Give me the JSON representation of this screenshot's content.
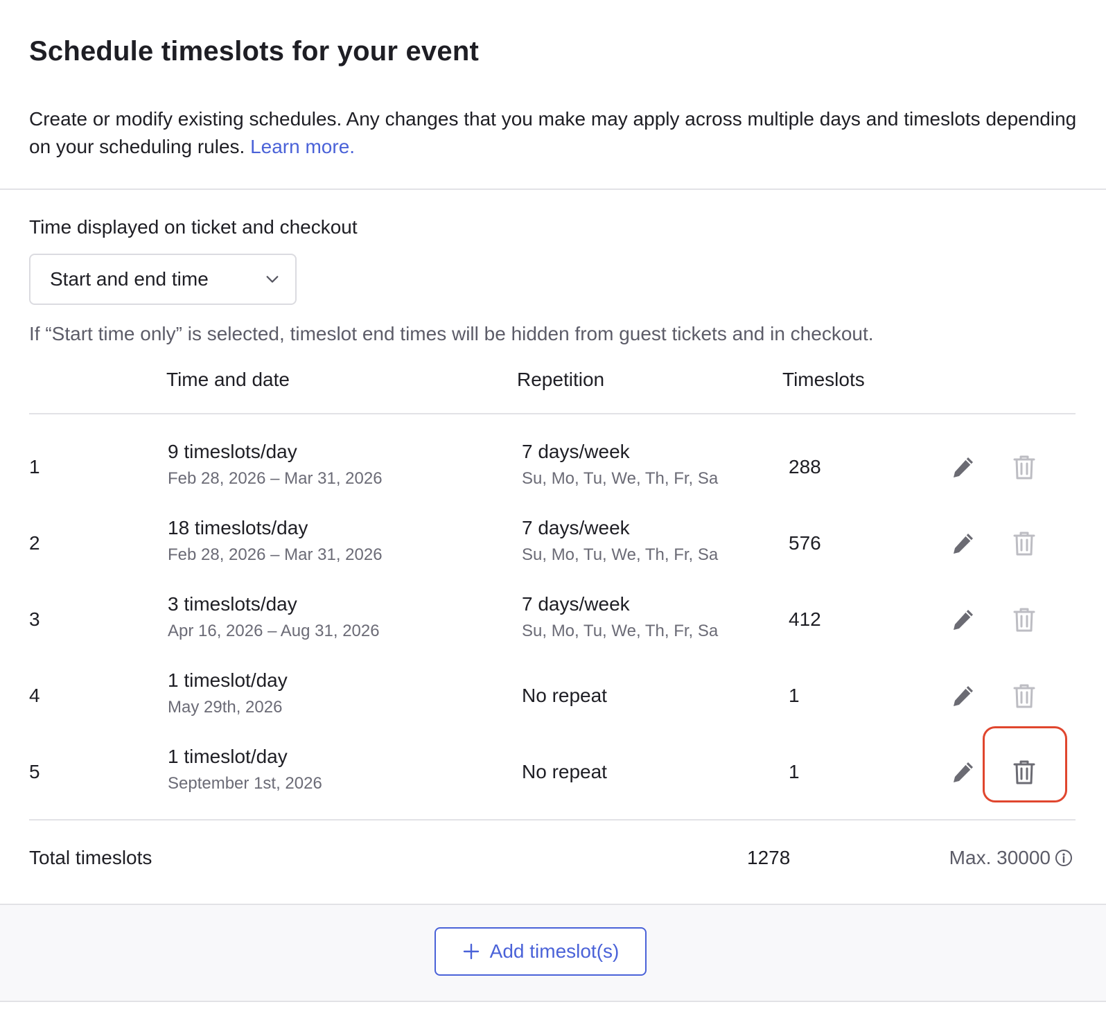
{
  "header": {
    "title": "Schedule timeslots for your event",
    "intro_text": "Create or modify existing schedules. Any changes that you make may apply across multiple days and timeslots depending on your scheduling rules.",
    "learn_more": "Learn more."
  },
  "display_time": {
    "label": "Time displayed on ticket and checkout",
    "selected": "Start and end time",
    "hint": "If “Start time only” is selected, timeslot end times will be hidden from guest tickets and in checkout."
  },
  "table": {
    "columns": {
      "time_and_date": "Time and date",
      "repetition": "Repetition",
      "timeslots": "Timeslots"
    },
    "rows": [
      {
        "index": "1",
        "per_day": "9 timeslots/day",
        "dates": "Feb 28, 2026 – Mar 31, 2026",
        "repetition": "7 days/week",
        "days": "Su, Mo, Tu, We, Th, Fr, Sa",
        "count": "288"
      },
      {
        "index": "2",
        "per_day": "18 timeslots/day",
        "dates": "Feb 28, 2026 – Mar 31, 2026",
        "repetition": "7 days/week",
        "days": "Su, Mo, Tu, We, Th, Fr, Sa",
        "count": "576"
      },
      {
        "index": "3",
        "per_day": "3 timeslots/day",
        "dates": "Apr 16, 2026 – Aug 31, 2026",
        "repetition": "7 days/week",
        "days": "Su, Mo, Tu, We, Th, Fr, Sa",
        "count": "412"
      },
      {
        "index": "4",
        "per_day": "1 timeslot/day",
        "dates": "May 29th, 2026",
        "repetition": "No repeat",
        "days": "",
        "count": "1"
      },
      {
        "index": "5",
        "per_day": "1 timeslot/day",
        "dates": "September 1st, 2026",
        "repetition": "No repeat",
        "days": "",
        "count": "1"
      }
    ],
    "total": {
      "label": "Total timeslots",
      "value": "1278",
      "max": "Max. 30000"
    }
  },
  "footer": {
    "add_button": "Add timeslot(s)"
  },
  "icons": {
    "edit": "pencil-icon",
    "delete": "trash-icon",
    "dropdown": "chevron-down-icon",
    "info": "info-icon",
    "add": "plus-icon"
  },
  "colors": {
    "accent": "#4a62d8",
    "highlight": "#e0462e",
    "icon_dark": "#6b6b73",
    "icon_muted": "#bdbdc3"
  }
}
